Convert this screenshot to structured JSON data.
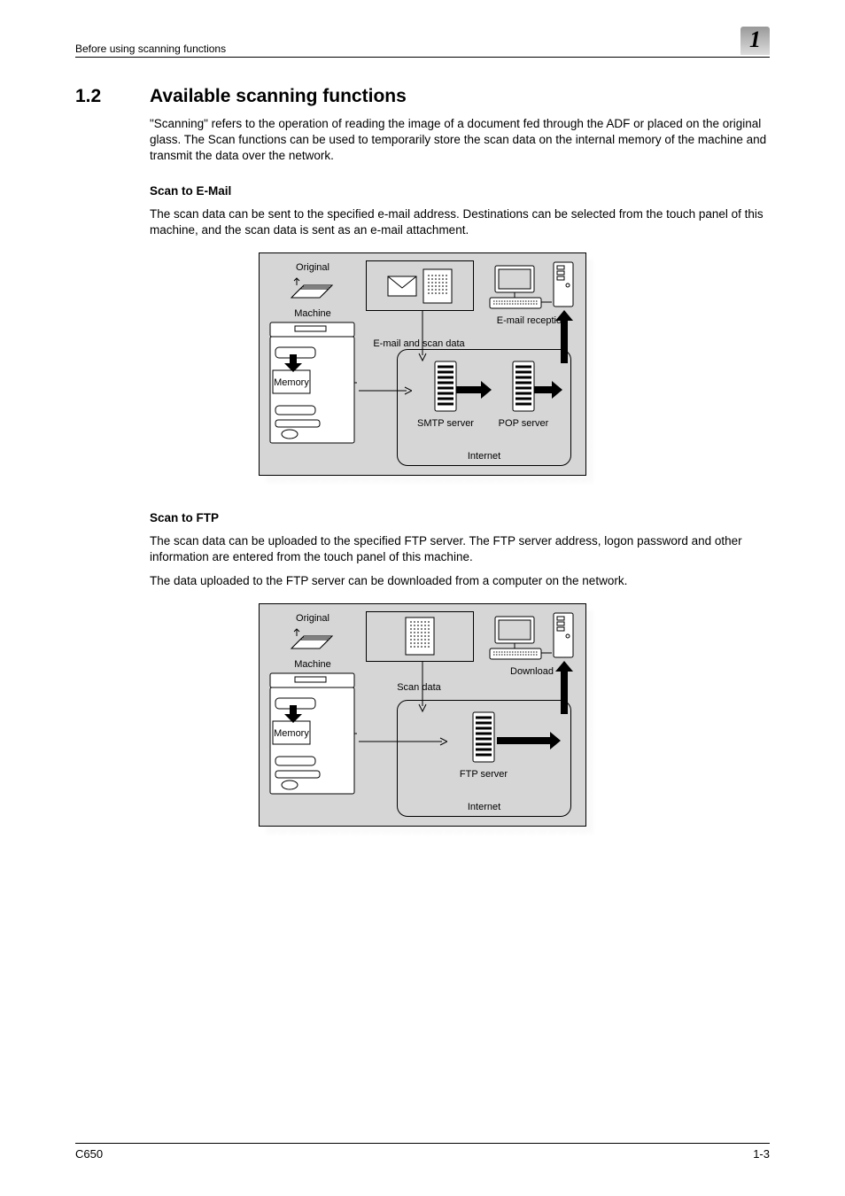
{
  "header": {
    "breadcrumb": "Before using scanning functions",
    "chapter_number": "1"
  },
  "section": {
    "number": "1.2",
    "title": "Available scanning functions",
    "intro": "\"Scanning\" refers to the operation of reading the image of a document fed through the ADF or placed on the original glass. The Scan functions can be used to temporarily store the scan data on the internal memory of the machine and transmit the data over the network."
  },
  "email": {
    "heading": "Scan to E-Mail",
    "body": "The scan data can be sent to the specified e-mail address. Destinations can be selected from the touch panel of this machine, and the scan data is sent as an e-mail attachment.",
    "diagram": {
      "original_label": "Original",
      "machine_label": "Machine",
      "memory_label": "Memory",
      "envelope_caption": "E-mail and scan data",
      "reception_label": "E-mail reception",
      "server1_label": "SMTP server",
      "server2_label": "POP server",
      "internet_label": "Internet"
    }
  },
  "ftp": {
    "heading": "Scan to FTP",
    "body1": "The scan data can be uploaded to the specified FTP server. The FTP server address, logon password and other information are entered from the touch panel of this machine.",
    "body2": "The data uploaded to the FTP server can be downloaded from a computer on the network.",
    "diagram": {
      "original_label": "Original",
      "machine_label": "Machine",
      "memory_label": "Memory",
      "scan_data_label": "Scan data",
      "download_label": "Download",
      "ftp_server_label": "FTP server",
      "internet_label": "Internet"
    }
  },
  "footer": {
    "model": "C650",
    "page_number": "1-3"
  }
}
